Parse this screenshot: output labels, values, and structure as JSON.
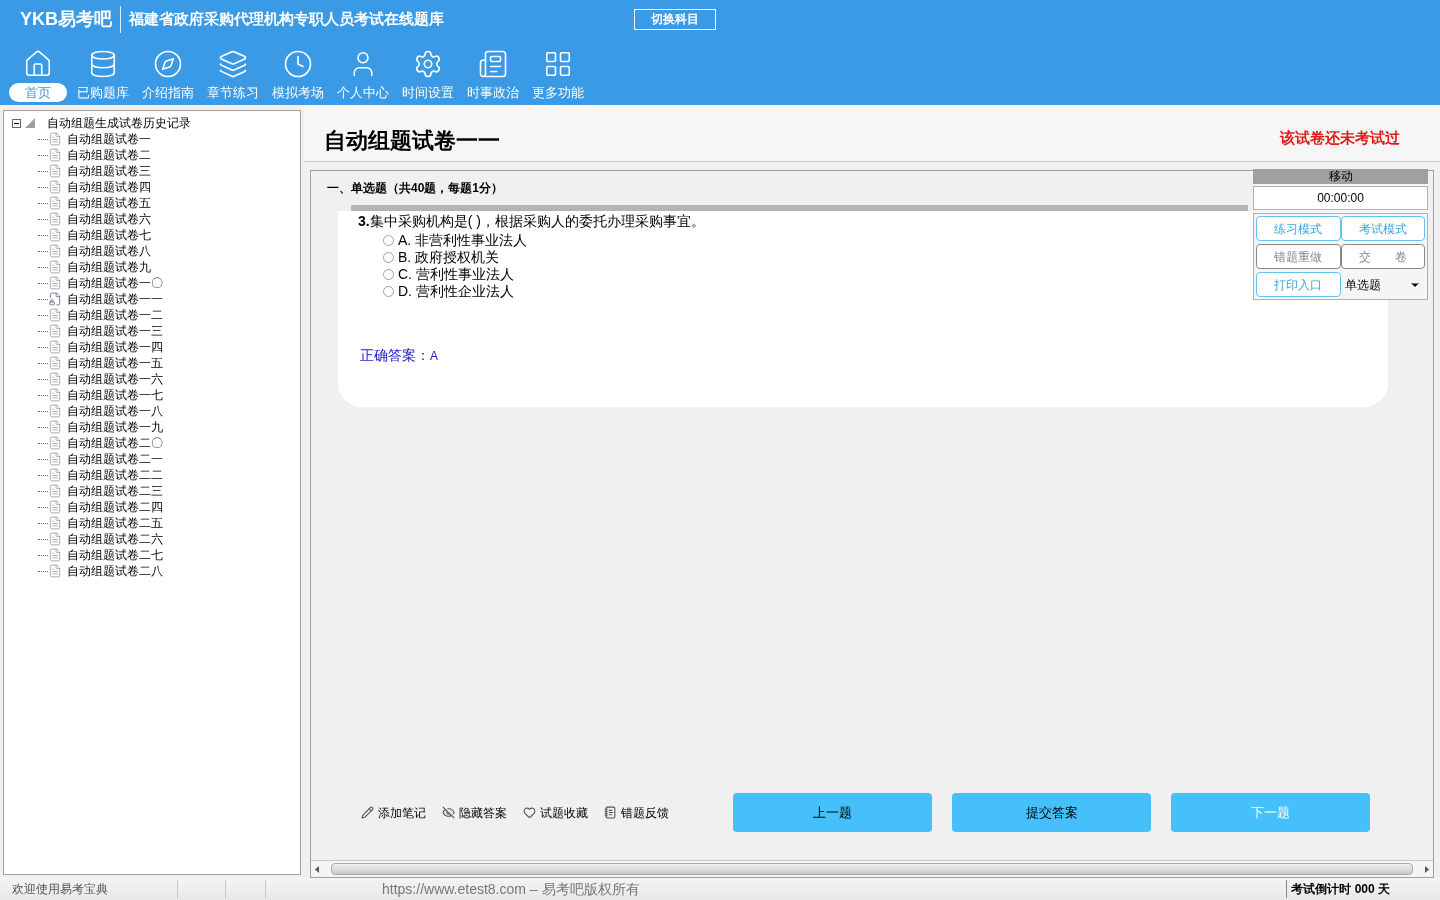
{
  "header": {
    "brand": "YKB易考吧",
    "title": "福建省政府采购代理机构专职人员考试在线题库",
    "switch_button": "切换科目"
  },
  "nav": [
    {
      "label": "首页",
      "selected": true
    },
    {
      "label": "已购题库",
      "selected": false
    },
    {
      "label": "介绍指南",
      "selected": false
    },
    {
      "label": "章节练习",
      "selected": false
    },
    {
      "label": "模拟考场",
      "selected": false
    },
    {
      "label": "个人中心",
      "selected": false
    },
    {
      "label": "时间设置",
      "selected": false
    },
    {
      "label": "时事政治",
      "selected": false
    },
    {
      "label": "更多功能",
      "selected": false
    }
  ],
  "tree": {
    "label": "自动组题生成试卷历史记录",
    "expanded": true,
    "children": [
      {
        "label": "自动组题试卷一",
        "kind": "doc"
      },
      {
        "label": "自动组题试卷二",
        "kind": "doc"
      },
      {
        "label": "自动组题试卷三",
        "kind": "doc"
      },
      {
        "label": "自动组题试卷四",
        "kind": "doc"
      },
      {
        "label": "自动组题试卷五",
        "kind": "doc"
      },
      {
        "label": "自动组题试卷六",
        "kind": "doc"
      },
      {
        "label": "自动组题试卷七",
        "kind": "doc"
      },
      {
        "label": "自动组题试卷八",
        "kind": "doc"
      },
      {
        "label": "自动组题试卷九",
        "kind": "doc"
      },
      {
        "label": "自动组题试卷一〇",
        "kind": "doc"
      },
      {
        "label": "自动组题试卷一一",
        "kind": "current"
      },
      {
        "label": "自动组题试卷一二",
        "kind": "doc"
      },
      {
        "label": "自动组题试卷一三",
        "kind": "doc"
      },
      {
        "label": "自动组题试卷一四",
        "kind": "doc"
      },
      {
        "label": "自动组题试卷一五",
        "kind": "doc"
      },
      {
        "label": "自动组题试卷一六",
        "kind": "doc"
      },
      {
        "label": "自动组题试卷一七",
        "kind": "doc"
      },
      {
        "label": "自动组题试卷一八",
        "kind": "doc"
      },
      {
        "label": "自动组题试卷一九",
        "kind": "doc"
      },
      {
        "label": "自动组题试卷二〇",
        "kind": "doc"
      },
      {
        "label": "自动组题试卷二一",
        "kind": "doc"
      },
      {
        "label": "自动组题试卷二二",
        "kind": "doc"
      },
      {
        "label": "自动组题试卷二三",
        "kind": "doc"
      },
      {
        "label": "自动组题试卷二四",
        "kind": "doc"
      },
      {
        "label": "自动组题试卷二五",
        "kind": "doc"
      },
      {
        "label": "自动组题试卷二六",
        "kind": "doc"
      },
      {
        "label": "自动组题试卷二七",
        "kind": "doc"
      },
      {
        "label": "自动组题试卷二八",
        "kind": "doc"
      }
    ]
  },
  "paper": {
    "title": "自动组题试卷一一",
    "status": "该试卷还未考试过"
  },
  "section": "一、单选题（共40题，每题1分）",
  "question": {
    "number": "3.",
    "text": "集中采购机构是( )，根据采购人的委托办理采购事宜。",
    "options": [
      {
        "label": "A. 非营利性事业法人",
        "selected": false
      },
      {
        "label": "B. 政府授权机关",
        "selected": false
      },
      {
        "label": "C. 营利性事业法人",
        "selected": false
      },
      {
        "label": "D. 营利性企业法人",
        "selected": false
      }
    ],
    "answer_label": "正确答案：",
    "answer": "A"
  },
  "side_panel": {
    "handle": "移动",
    "timer": "00:00:00",
    "buttons": [
      {
        "label": "练习模式",
        "kind": "blue"
      },
      {
        "label": "考试模式",
        "kind": "blue"
      },
      {
        "label": "错题重做",
        "kind": "gray"
      },
      {
        "label": "交　　卷",
        "kind": "gray"
      },
      {
        "label": "打印入口",
        "kind": "blue"
      }
    ],
    "type_select": "单选题"
  },
  "tools": [
    "添加笔记",
    "隐藏答案",
    "试题收藏",
    "错题反馈"
  ],
  "nav_buttons": [
    {
      "label": "上一题",
      "disabled": false
    },
    {
      "label": "提交答案",
      "disabled": false
    },
    {
      "label": "下一题",
      "disabled": true
    }
  ],
  "status_bar": {
    "welcome": "欢迎使用易考宝典",
    "copyright": "https://www.etest8.com – 易考吧版权所有",
    "countdown": "考试倒计时 000 天"
  }
}
